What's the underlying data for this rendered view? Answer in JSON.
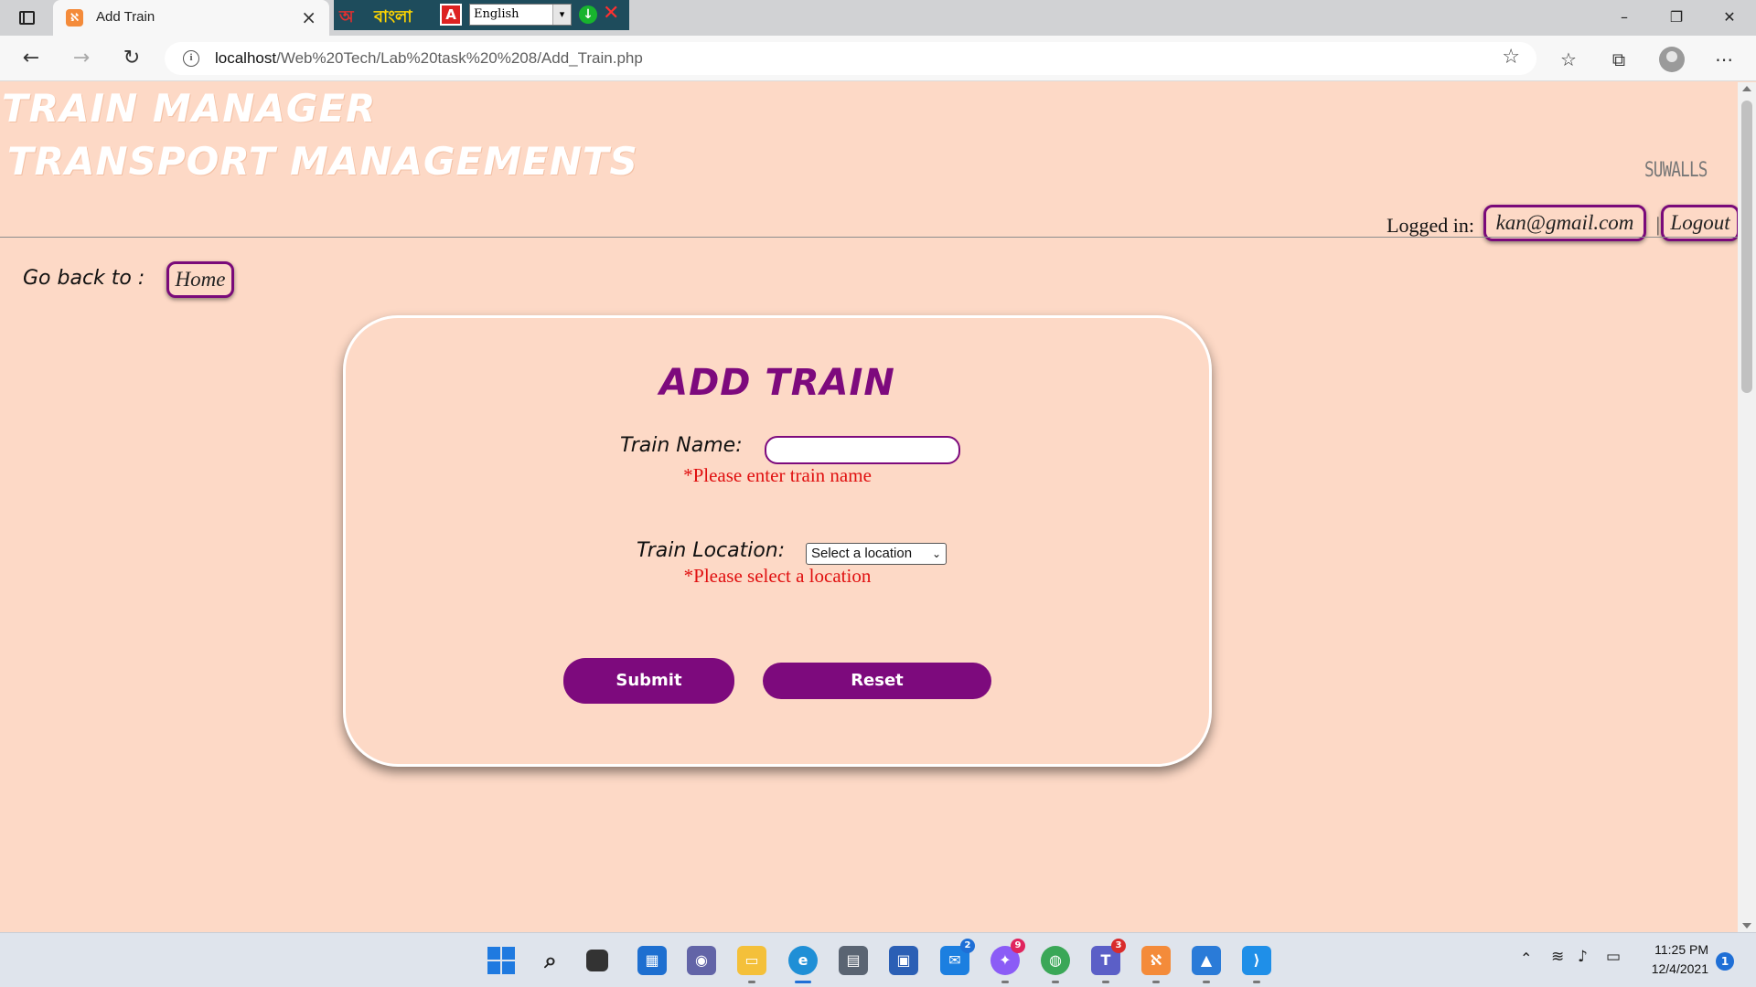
{
  "browser": {
    "tab_title": "Add Train",
    "tab_favicon": "xampp-icon",
    "extension": {
      "bengali_text": "বাংলা",
      "language_value": "English"
    },
    "url_host": "localhost",
    "url_path": "/Web%20Tech/Lab%20task%20%208/Add_Train.php"
  },
  "header": {
    "site_title": "TRAIN MANAGER",
    "site_subtitle": "TRANSPORT MANAGEMENTS",
    "brand_logo": "SUWALLS",
    "logged_label": "Logged in:",
    "user_email": "kan@gmail.com",
    "separator": "|",
    "logout_label": "Logout"
  },
  "nav": {
    "goback_label": "Go back to :",
    "home_label": "Home"
  },
  "form": {
    "title": "ADD TRAIN",
    "train_name_label": "Train Name:",
    "train_name_value": "",
    "train_name_error": "*Please enter train name",
    "train_location_label": "Train Location:",
    "location_selected": "Select a location",
    "location_error": "*Please select a location",
    "submit_label": "Submit",
    "reset_label": "Reset"
  },
  "taskbar": {
    "time": "11:25 PM",
    "date": "12/4/2021",
    "badges": {
      "mail": "2",
      "messenger": "9",
      "teams": "3",
      "notifications": "1"
    }
  },
  "colors": {
    "page_background": "#fdd9c6",
    "accent_purple": "#7d0a7d",
    "error_red": "#e01010"
  }
}
